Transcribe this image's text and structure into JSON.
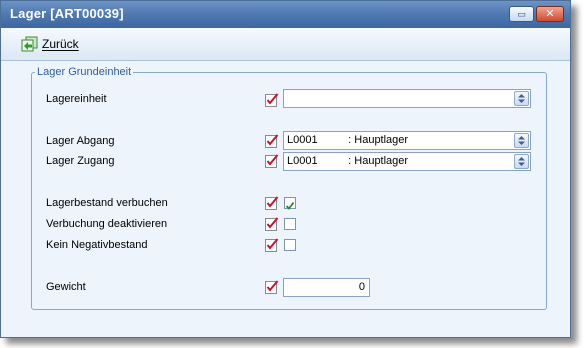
{
  "window": {
    "title": "Lager [ART00039]",
    "restore_glyph": "▭",
    "close_glyph": "✕"
  },
  "toolbar": {
    "back_label": "Zurück"
  },
  "group": {
    "title": "Lager Grundeinheit"
  },
  "fields": {
    "lagereinheit": {
      "label": "Lagereinheit",
      "value": ""
    },
    "lager_abgang": {
      "label": "Lager Abgang",
      "value": "L0001          : Hauptlager"
    },
    "lager_zugang": {
      "label": "Lager Zugang",
      "value": "L0001          : Hauptlager"
    },
    "lagerbestand_verbuchen": {
      "label": "Lagerbestand verbuchen",
      "checked": true
    },
    "verbuchung_deaktivieren": {
      "label": "Verbuchung deaktivieren",
      "checked": false
    },
    "kein_negativbestand": {
      "label": "Kein Negativbestand",
      "checked": false
    },
    "gewicht": {
      "label": "Gewicht",
      "value": "0"
    }
  },
  "icons": {
    "field_marker": "checklist-icon",
    "back": "back-arrow-icon",
    "spinner": "up-down-spinner-icon",
    "checkmark": "checkmark-icon"
  },
  "colors": {
    "titlebar": "#4e78b0",
    "background": "#eef4fb",
    "group_title": "#2f5ea1",
    "checkmark": "#2a8a2a",
    "marker_red": "#c8102e"
  }
}
